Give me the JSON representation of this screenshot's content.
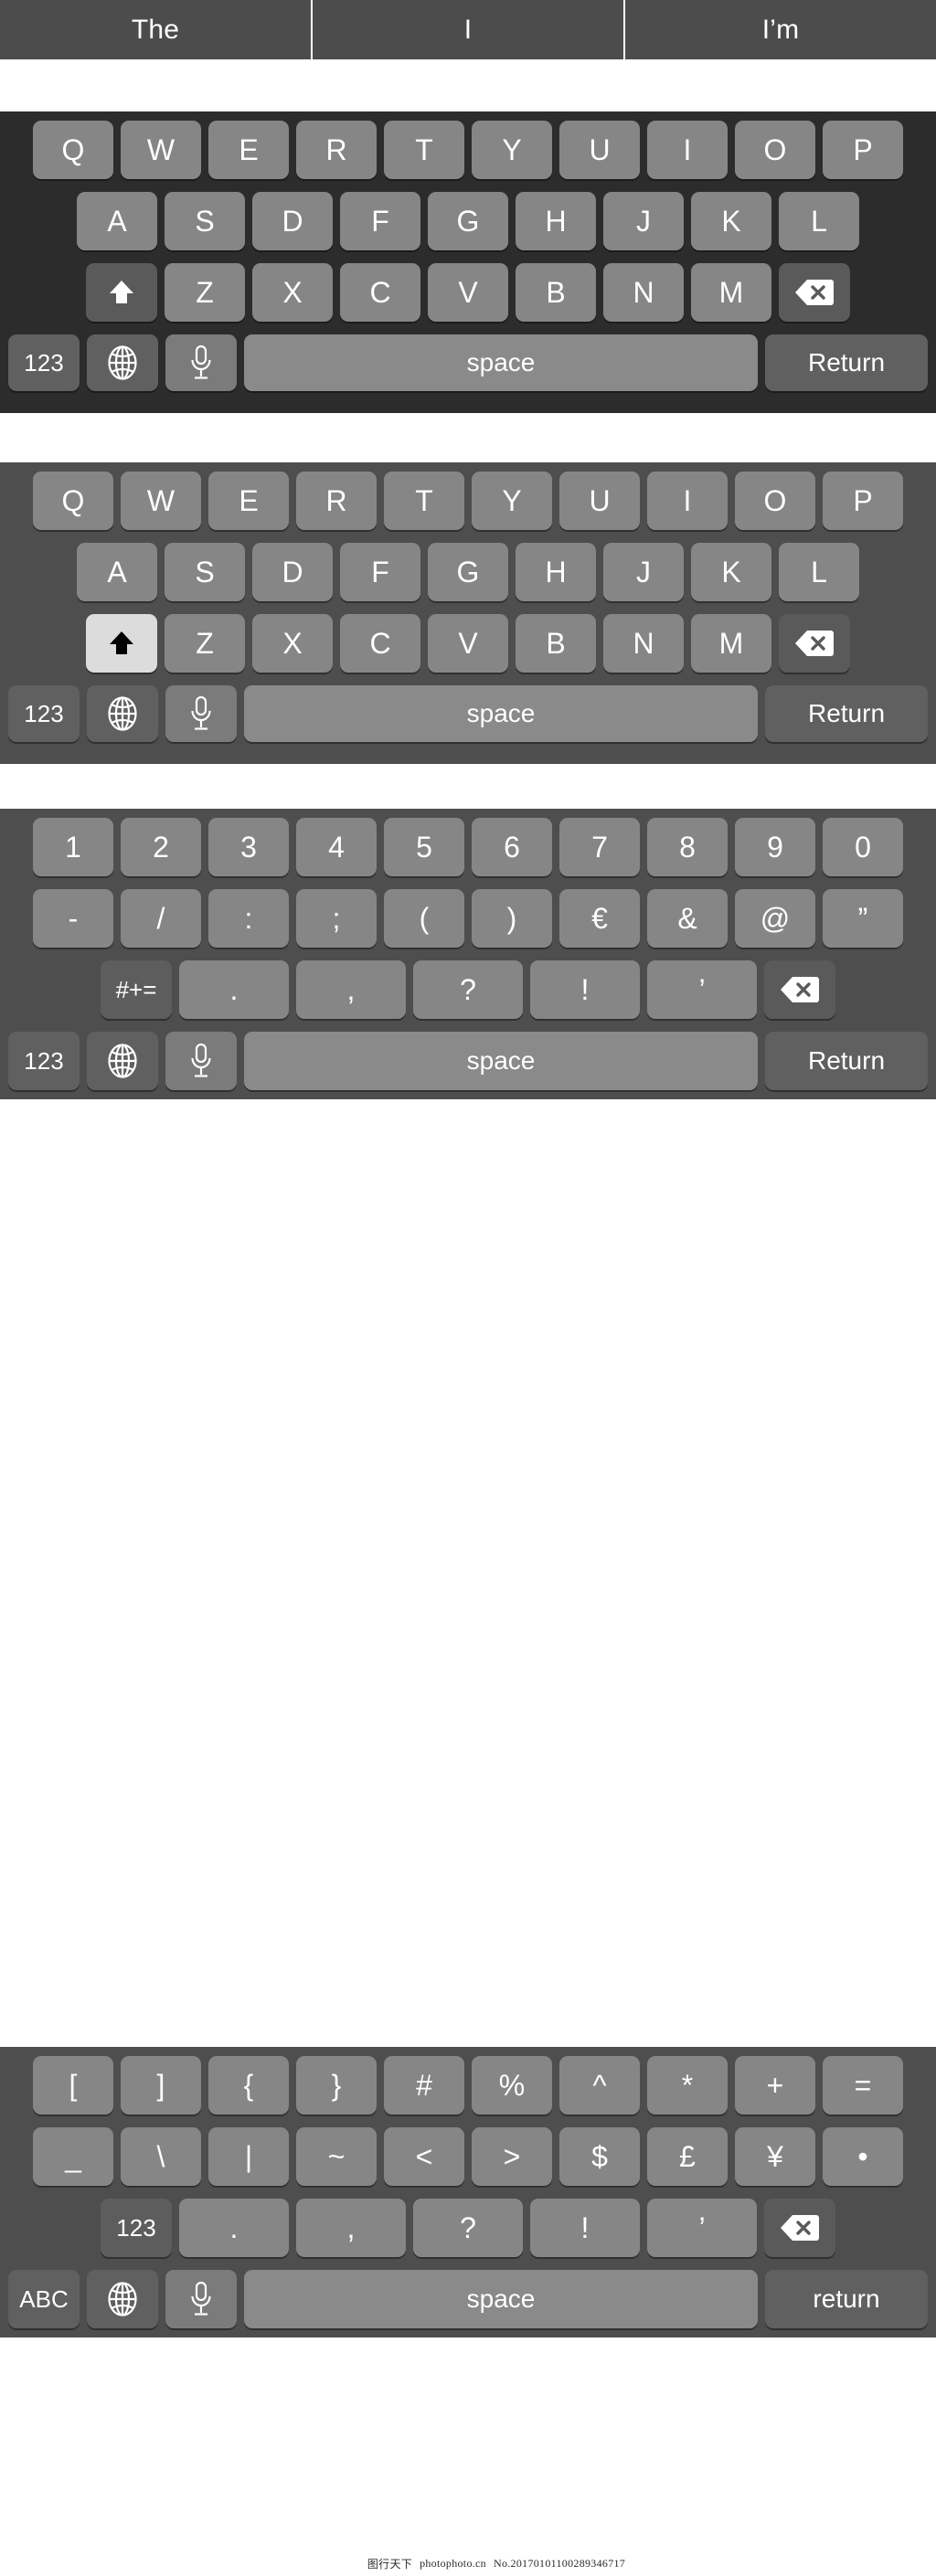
{
  "suggestion_bar": {
    "items": [
      {
        "label": "The"
      },
      {
        "label": "I"
      },
      {
        "label": "I’m"
      }
    ]
  },
  "colors": {
    "keyboard_dark_bg": "#2c2c2c",
    "keyboard_light_bg": "#4e4e4e",
    "key_bg": "#868686",
    "key_fn_bg": "#606060",
    "key_space_bg": "#8a8a8a",
    "shift_active_bg": "#dcdcdc",
    "key_text": "#ffffff",
    "suggestion_bar_bg": "#4c4c4c"
  },
  "keyboards": [
    {
      "name": "letters-uppercase-unshifted",
      "theme": "dark",
      "rows": {
        "row1": [
          "Q",
          "W",
          "E",
          "R",
          "T",
          "Y",
          "U",
          "I",
          "O",
          "P"
        ],
        "row2": [
          "A",
          "S",
          "D",
          "F",
          "G",
          "H",
          "J",
          "K",
          "L"
        ],
        "row3": [
          "Z",
          "X",
          "C",
          "V",
          "B",
          "N",
          "M"
        ]
      },
      "shift": {
        "icon": "shift-arrow-icon",
        "active": false
      },
      "backspace": {
        "icon": "backspace-icon"
      },
      "bottom": {
        "mode_label": "123",
        "globe_icon": "globe-icon",
        "mic_icon": "microphone-icon",
        "space_label": "space",
        "return_label": "Return"
      }
    },
    {
      "name": "letters-shift-active",
      "theme": "light",
      "rows": {
        "row1": [
          "Q",
          "W",
          "E",
          "R",
          "T",
          "Y",
          "U",
          "I",
          "O",
          "P"
        ],
        "row2": [
          "A",
          "S",
          "D",
          "F",
          "G",
          "H",
          "J",
          "K",
          "L"
        ],
        "row3": [
          "Z",
          "X",
          "C",
          "V",
          "B",
          "N",
          "M"
        ]
      },
      "shift": {
        "icon": "shift-arrow-icon",
        "active": true
      },
      "backspace": {
        "icon": "backspace-icon"
      },
      "bottom": {
        "mode_label": "123",
        "globe_icon": "globe-icon",
        "mic_icon": "microphone-icon",
        "space_label": "space",
        "return_label": "Return"
      }
    },
    {
      "name": "numbers-and-punctuation",
      "theme": "light",
      "rows": {
        "row1": [
          "1",
          "2",
          "3",
          "4",
          "5",
          "6",
          "7",
          "8",
          "9",
          "0"
        ],
        "row2": [
          "-",
          "/",
          ":",
          ";",
          "(",
          ")",
          "€",
          "&",
          "@",
          "”"
        ],
        "row3": [
          ".",
          ",",
          "?",
          "!",
          "’"
        ]
      },
      "alt_mode_label": "#+=",
      "backspace": {
        "icon": "backspace-icon"
      },
      "bottom": {
        "mode_label": "123",
        "globe_icon": "globe-icon",
        "mic_icon": "microphone-icon",
        "space_label": "space",
        "return_label": "Return"
      }
    },
    {
      "name": "symbols",
      "theme": "light",
      "rows": {
        "row1": [
          "[",
          "]",
          "{",
          "}",
          "#",
          "%",
          "^",
          "*",
          "+",
          "="
        ],
        "row2": [
          "_",
          "\\",
          "|",
          "~",
          "<",
          ">",
          "$",
          "£",
          "¥",
          "•"
        ],
        "row3": [
          ".",
          ",",
          "?",
          "!",
          "’"
        ]
      },
      "alt_mode_label": "123",
      "backspace": {
        "icon": "backspace-icon"
      },
      "bottom": {
        "mode_label": "ABC",
        "globe_icon": "globe-icon",
        "mic_icon": "microphone-icon",
        "space_label": "space",
        "return_label": "return"
      }
    }
  ],
  "watermark": {
    "site_cn": "图行天下",
    "site_url": "photophoto.cn",
    "id": "No.20170101100289346717"
  }
}
